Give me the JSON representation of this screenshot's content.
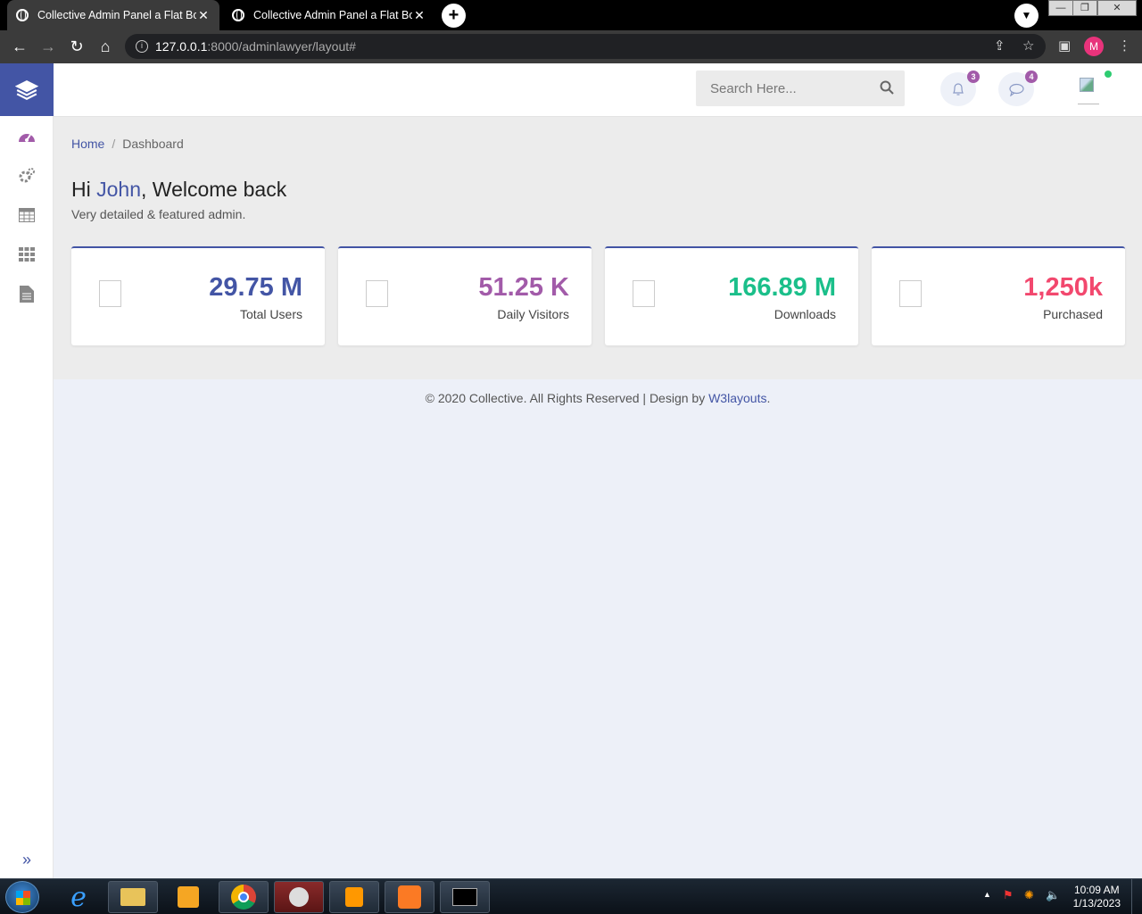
{
  "browser": {
    "tabs": [
      {
        "title": "Collective Admin Panel a Flat Boo",
        "active": true
      },
      {
        "title": "Collective Admin Panel a Flat Boo",
        "active": false
      }
    ],
    "url_host": "127.0.0.1",
    "url_path": ":8000/adminlawyer/layout#",
    "profile_initial": "M",
    "colors": {
      "tabbar": "#000000",
      "toolbar": "#3b3b3b",
      "profile": "#e8337b"
    }
  },
  "header": {
    "search_placeholder": "Search Here...",
    "notifications_count": "3",
    "messages_count": "4"
  },
  "sidebar": {
    "items": [
      "dashboard-icon",
      "settings-icon",
      "table-icon",
      "grid-icon",
      "document-icon"
    ]
  },
  "breadcrumb": {
    "home": "Home",
    "separator": "/",
    "current": "Dashboard"
  },
  "welcome": {
    "prefix": "Hi ",
    "name": "John",
    "suffix": ", Welcome back",
    "subtitle": "Very detailed & featured admin."
  },
  "stats": [
    {
      "value": "29.75 M",
      "label": "Total Users",
      "color": "#4355a5"
    },
    {
      "value": "51.25 K",
      "label": "Daily Visitors",
      "color": "#a25ba9"
    },
    {
      "value": "166.89 M",
      "label": "Downloads",
      "color": "#1bbf8a"
    },
    {
      "value": "1,250k",
      "label": "Purchased",
      "color": "#f2486e"
    }
  ],
  "footer": {
    "text": "© 2020 Collective. All Rights Reserved | Design by ",
    "link": "W3layouts",
    "end": "."
  },
  "taskbar": {
    "time": "10:09 AM",
    "date": "1/13/2023"
  },
  "colors": {
    "primary": "#4355a5",
    "badge": "#a25ba9"
  }
}
